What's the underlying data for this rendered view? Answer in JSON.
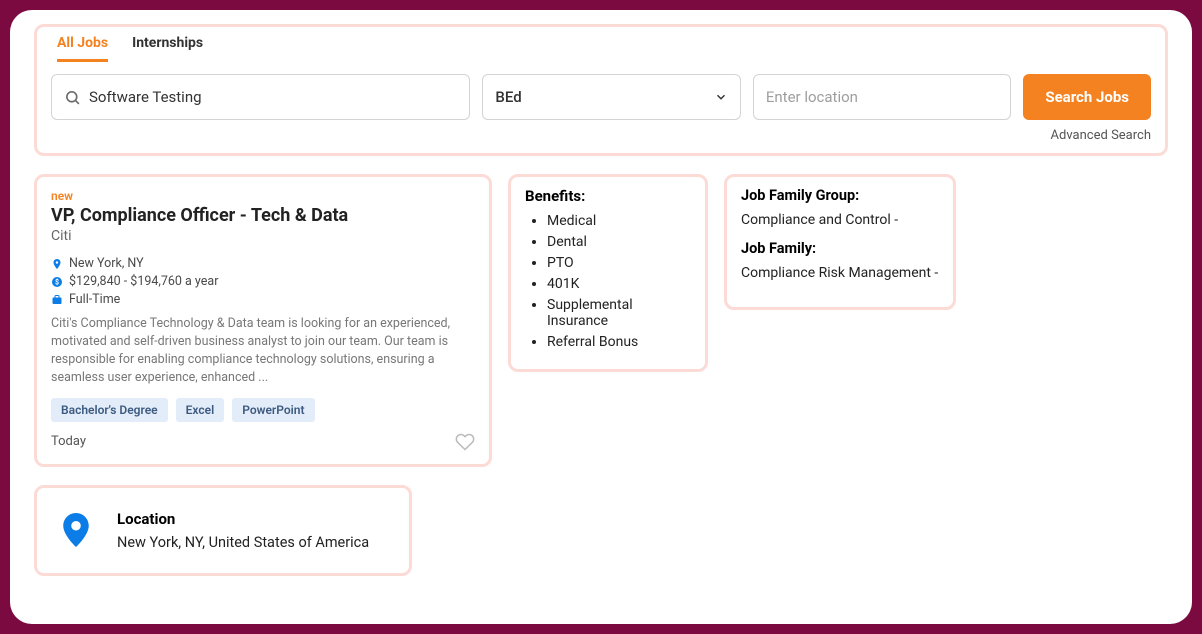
{
  "search": {
    "tabs": {
      "all": "All Jobs",
      "internships": "Internships"
    },
    "keyword_value": "Software Testing",
    "education_value": "BEd",
    "location_placeholder": "Enter location",
    "button": "Search Jobs",
    "advanced": "Advanced Search"
  },
  "job": {
    "new": "new",
    "title": "VP, Compliance Officer - Tech & Data",
    "company": "Citi",
    "location": "New York, NY",
    "salary": "$129,840 - $194,760 a year",
    "employment": "Full-Time",
    "description": "Citi's Compliance Technology & Data team is looking for an experienced, motivated and self-driven business analyst to join our team. Our team is responsible for enabling compliance technology solutions, ensuring a seamless user experience, enhanced ...",
    "tags": [
      "Bachelor's Degree",
      "Excel",
      "PowerPoint"
    ],
    "posted": "Today"
  },
  "benefits": {
    "heading": "Benefits:",
    "items": [
      "Medical",
      "Dental",
      "PTO",
      "401K",
      "Supplemental Insurance",
      "Referral Bonus"
    ]
  },
  "jobfamily": {
    "group_label": "Job Family Group:",
    "group_value": "Compliance and Control -",
    "family_label": "Job Family:",
    "family_value": "Compliance Risk Management -"
  },
  "location_block": {
    "label": "Location",
    "value": "New York, NY, United States of America"
  }
}
